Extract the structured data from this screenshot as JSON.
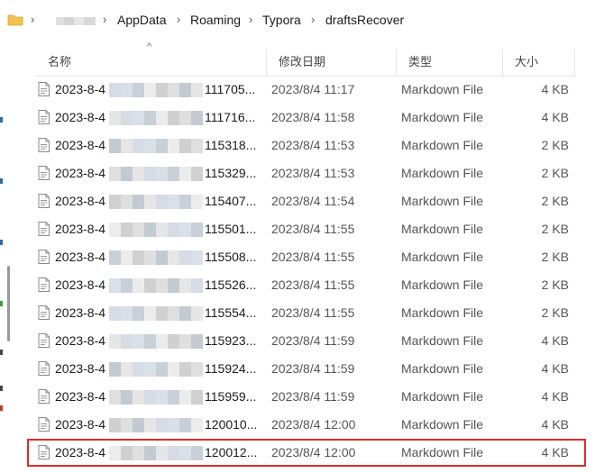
{
  "breadcrumb": {
    "items": [
      "AppData",
      "Roaming",
      "Typora",
      "draftsRecover"
    ],
    "separator": "›"
  },
  "columns": {
    "name": "名称",
    "modified": "修改日期",
    "type": "类型",
    "size": "大小"
  },
  "sort_indicator": "^",
  "colors": {
    "selection_outline": "#e02a2a",
    "folder": "#f2c14e"
  },
  "files": [
    {
      "name_prefix": "2023-8-4",
      "name_suffix": "111705...",
      "modified": "2023/8/4 11:17",
      "type": "Markdown File",
      "size": "4 KB"
    },
    {
      "name_prefix": "2023-8-4",
      "name_suffix": "111716...",
      "modified": "2023/8/4 11:58",
      "type": "Markdown File",
      "size": "4 KB"
    },
    {
      "name_prefix": "2023-8-4",
      "name_suffix": "115318...",
      "modified": "2023/8/4 11:53",
      "type": "Markdown File",
      "size": "2 KB"
    },
    {
      "name_prefix": "2023-8-4",
      "name_suffix": "115329...",
      "modified": "2023/8/4 11:53",
      "type": "Markdown File",
      "size": "2 KB"
    },
    {
      "name_prefix": "2023-8-4",
      "name_suffix": "115407...",
      "modified": "2023/8/4 11:54",
      "type": "Markdown File",
      "size": "2 KB"
    },
    {
      "name_prefix": "2023-8-4",
      "name_suffix": "115501...",
      "modified": "2023/8/4 11:55",
      "type": "Markdown File",
      "size": "2 KB"
    },
    {
      "name_prefix": "2023-8-4",
      "name_suffix": "115508...",
      "modified": "2023/8/4 11:55",
      "type": "Markdown File",
      "size": "2 KB"
    },
    {
      "name_prefix": "2023-8-4",
      "name_suffix": "115526...",
      "modified": "2023/8/4 11:55",
      "type": "Markdown File",
      "size": "2 KB"
    },
    {
      "name_prefix": "2023-8-4",
      "name_suffix": "115554...",
      "modified": "2023/8/4 11:55",
      "type": "Markdown File",
      "size": "2 KB"
    },
    {
      "name_prefix": "2023-8-4",
      "name_suffix": "115923...",
      "modified": "2023/8/4 11:59",
      "type": "Markdown File",
      "size": "4 KB"
    },
    {
      "name_prefix": "2023-8-4",
      "name_suffix": "115924...",
      "modified": "2023/8/4 11:59",
      "type": "Markdown File",
      "size": "4 KB"
    },
    {
      "name_prefix": "2023-8-4",
      "name_suffix": "115959...",
      "modified": "2023/8/4 11:59",
      "type": "Markdown File",
      "size": "4 KB"
    },
    {
      "name_prefix": "2023-8-4",
      "name_suffix": "120010...",
      "modified": "2023/8/4 12:00",
      "type": "Markdown File",
      "size": "4 KB"
    },
    {
      "name_prefix": "2023-8-4",
      "name_suffix": "120012...",
      "modified": "2023/8/4 12:00",
      "type": "Markdown File",
      "size": "4 KB",
      "selected": true
    }
  ]
}
